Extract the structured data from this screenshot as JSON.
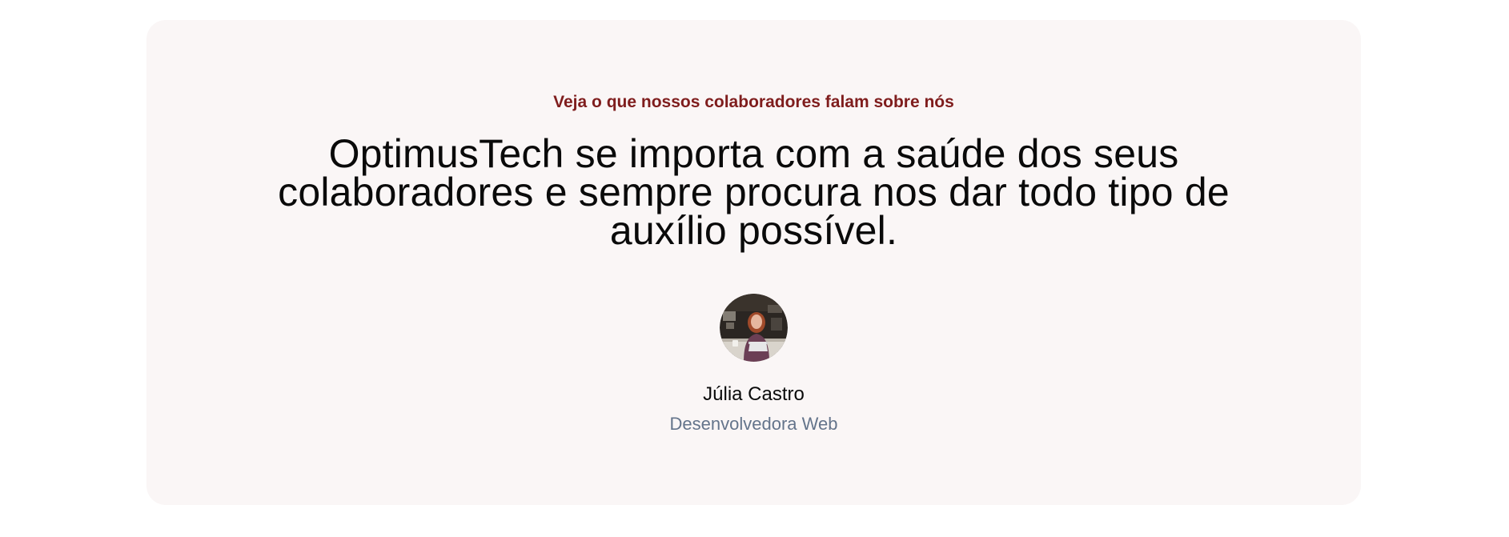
{
  "testimonial": {
    "eyebrow": "Veja o que nossos colaboradores falam sobre nós",
    "quote": "OptimusTech se importa com a saúde dos seus colaboradores e sempre procura nos dar todo tipo de auxílio possível.",
    "author": {
      "name": "Júlia Castro",
      "role": "Desenvolvedora Web",
      "avatar_icon": "avatar-photo-woman-laptop"
    }
  },
  "colors": {
    "page_background": "#ffffff",
    "card_background": "#faf6f6",
    "accent": "#7f1d1d",
    "heading": "#0a0a0a",
    "muted": "#64748b"
  }
}
